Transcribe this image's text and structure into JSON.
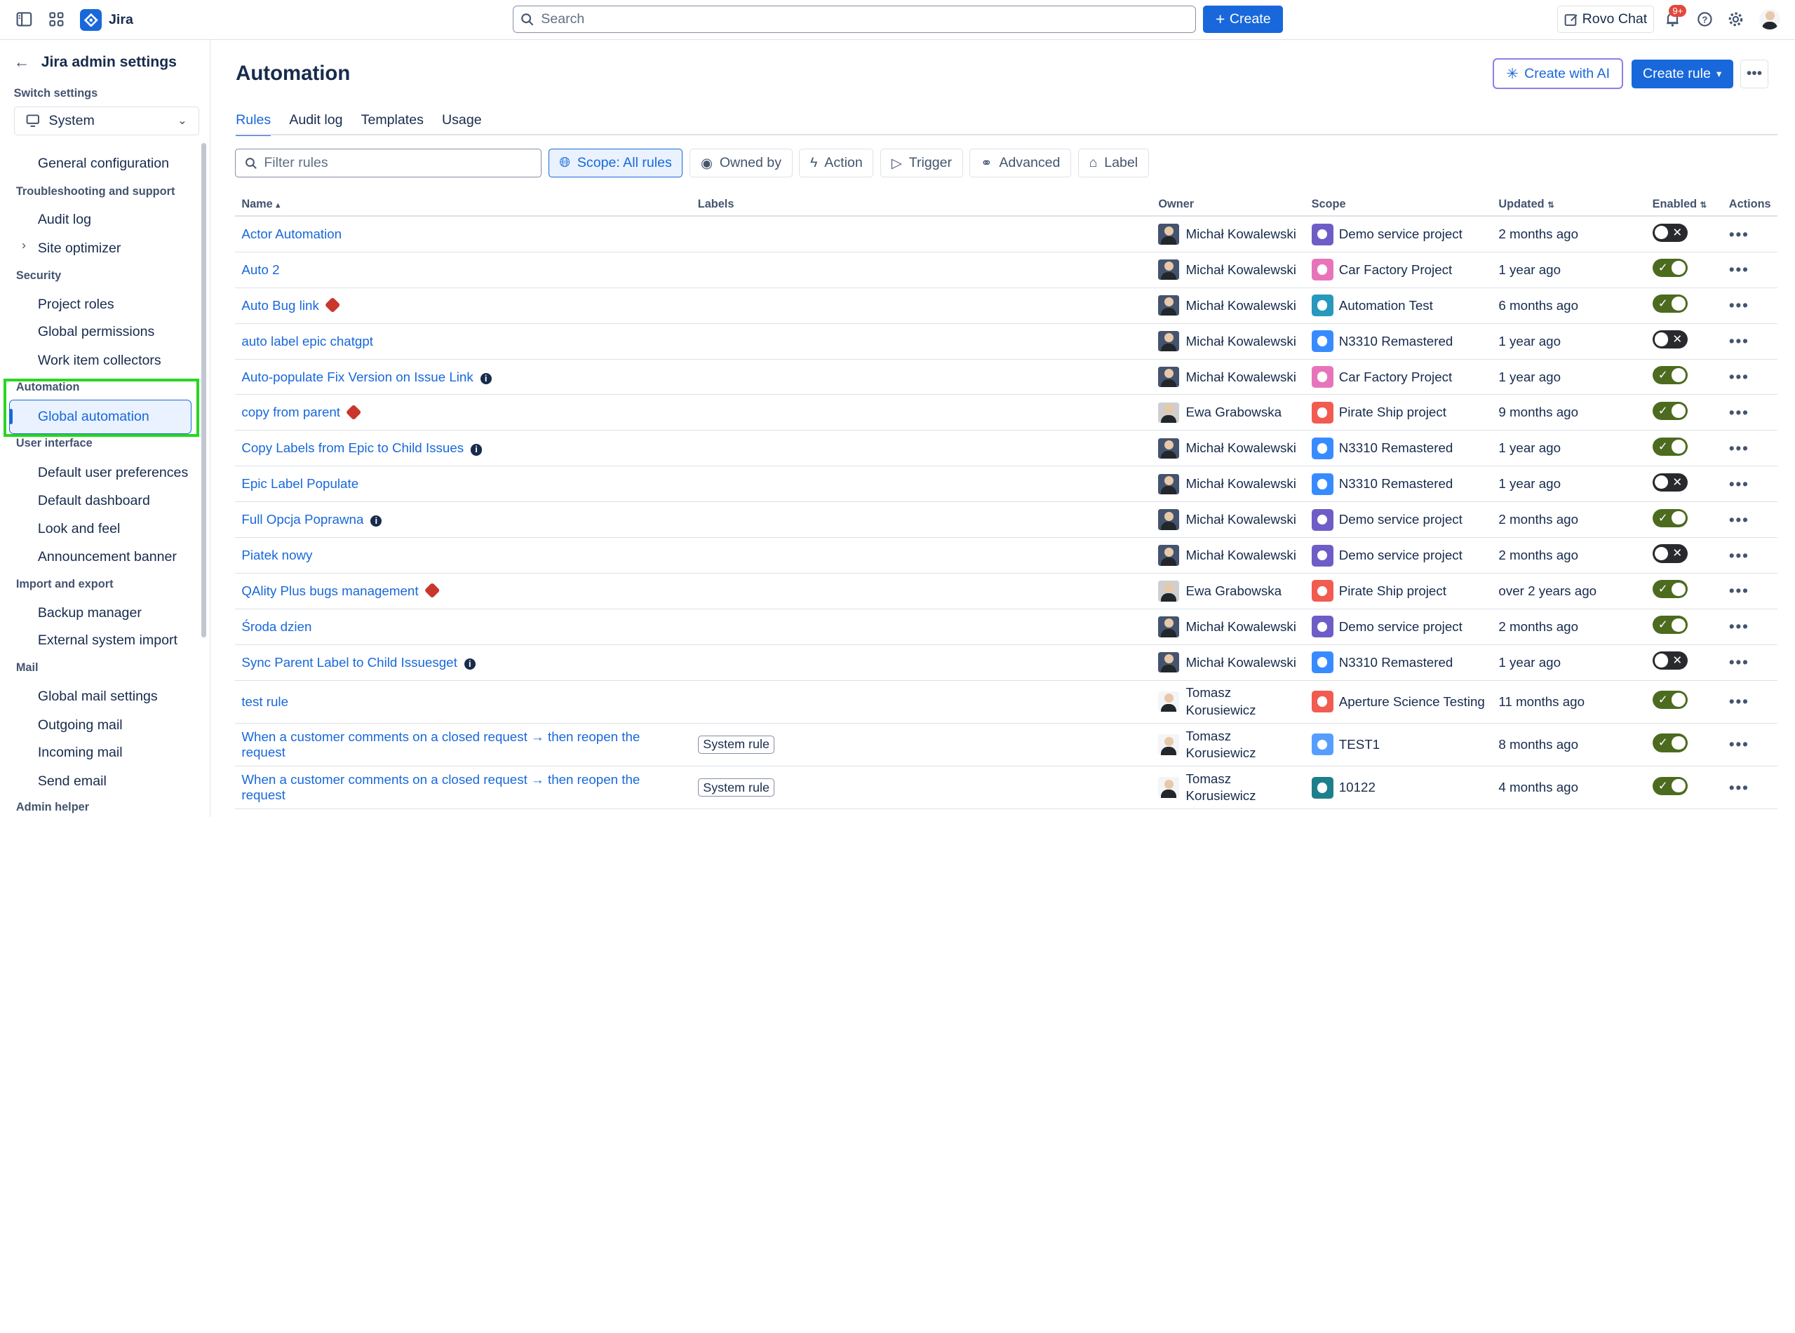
{
  "topbar": {
    "app_name": "Jira",
    "search_placeholder": "Search",
    "create_label": "Create",
    "rovo_label": "Rovo Chat",
    "notification_count": "9+"
  },
  "sidebar": {
    "title": "Jira admin settings",
    "switch_label": "Switch settings",
    "switch_value": "System",
    "general_configuration": "General configuration",
    "sec_troubleshooting": "Troubleshooting and support",
    "audit_log": "Audit log",
    "site_optimizer": "Site optimizer",
    "sec_security": "Security",
    "project_roles": "Project roles",
    "global_permissions": "Global permissions",
    "work_item_collectors": "Work item collectors",
    "sec_automation": "Automation",
    "global_automation": "Global automation",
    "sec_user_interface": "User interface",
    "default_user_preferences": "Default user preferences",
    "default_dashboard": "Default dashboard",
    "look_and_feel": "Look and feel",
    "announcement_banner": "Announcement banner",
    "sec_import_export": "Import and export",
    "backup_manager": "Backup manager",
    "external_system_import": "External system import",
    "sec_mail": "Mail",
    "global_mail_settings": "Global mail settings",
    "outgoing_mail": "Outgoing mail",
    "incoming_mail": "Incoming mail",
    "send_email": "Send email",
    "sec_admin_helper": "Admin helper"
  },
  "main": {
    "title": "Automation",
    "create_ai": "Create with AI",
    "create_rule": "Create rule",
    "tabs": {
      "rules": "Rules",
      "audit_log": "Audit log",
      "templates": "Templates",
      "usage": "Usage"
    },
    "filter_placeholder": "Filter rules",
    "filters": {
      "scope": "Scope: All rules",
      "owned_by": "Owned by",
      "action": "Action",
      "trigger": "Trigger",
      "advanced": "Advanced",
      "label": "Label"
    },
    "columns": {
      "name": "Name",
      "labels": "Labels",
      "owner": "Owner",
      "scope": "Scope",
      "updated": "Updated",
      "enabled": "Enabled",
      "actions": "Actions"
    }
  },
  "colors": {
    "accent": "#1868DB",
    "toggle_on": "#4C6B1F",
    "toggle_off": "#292A2E",
    "highlight": "#27D720",
    "warning": "#C9372C"
  },
  "rules": [
    {
      "name": "Actor Automation",
      "flag": "",
      "label": "",
      "owner": "Michał Kowalewski",
      "avatar": "dark",
      "scope": "Demo service project",
      "scope_color": "#6E5DC6",
      "updated": "2 months ago",
      "enabled": false
    },
    {
      "name": "Auto 2",
      "flag": "",
      "label": "",
      "owner": "Michał Kowalewski",
      "avatar": "dark",
      "scope": "Car Factory Project",
      "scope_color": "#E774BB",
      "updated": "1 year ago",
      "enabled": true
    },
    {
      "name": "Auto Bug link",
      "flag": "warning",
      "label": "",
      "owner": "Michał Kowalewski",
      "avatar": "dark",
      "scope": "Automation Test",
      "scope_color": "#2898BD",
      "updated": "6 months ago",
      "enabled": true
    },
    {
      "name": "auto label epic chatgpt",
      "flag": "",
      "label": "",
      "owner": "Michał Kowalewski",
      "avatar": "dark",
      "scope": "N3310 Remastered",
      "scope_color": "#388BFF",
      "updated": "1 year ago",
      "enabled": false
    },
    {
      "name": "Auto-populate Fix Version on Issue Link",
      "flag": "info",
      "label": "",
      "owner": "Michał Kowalewski",
      "avatar": "dark",
      "scope": "Car Factory Project",
      "scope_color": "#E774BB",
      "updated": "1 year ago",
      "enabled": true
    },
    {
      "name": "copy from parent",
      "flag": "warning",
      "label": "",
      "owner": "Ewa Grabowska",
      "avatar": "light",
      "scope": "Pirate Ship project",
      "scope_color": "#F15B50",
      "updated": "9 months ago",
      "enabled": true
    },
    {
      "name": "Copy Labels from Epic to Child Issues",
      "flag": "info",
      "label": "",
      "owner": "Michał Kowalewski",
      "avatar": "dark",
      "scope": "N3310 Remastered",
      "scope_color": "#388BFF",
      "updated": "1 year ago",
      "enabled": true
    },
    {
      "name": "Epic Label Populate",
      "flag": "",
      "label": "",
      "owner": "Michał Kowalewski",
      "avatar": "dark",
      "scope": "N3310 Remastered",
      "scope_color": "#388BFF",
      "updated": "1 year ago",
      "enabled": false
    },
    {
      "name": "Full Opcja Poprawna",
      "flag": "info",
      "label": "",
      "owner": "Michał Kowalewski",
      "avatar": "dark",
      "scope": "Demo service project",
      "scope_color": "#6E5DC6",
      "updated": "2 months ago",
      "enabled": true
    },
    {
      "name": "Piatek nowy",
      "flag": "",
      "label": "",
      "owner": "Michał Kowalewski",
      "avatar": "dark",
      "scope": "Demo service project",
      "scope_color": "#6E5DC6",
      "updated": "2 months ago",
      "enabled": false
    },
    {
      "name": "QAlity Plus bugs management",
      "flag": "warning",
      "label": "",
      "owner": "Ewa Grabowska",
      "avatar": "light",
      "scope": "Pirate Ship project",
      "scope_color": "#F15B50",
      "updated": "over 2 years ago",
      "enabled": true
    },
    {
      "name": "Środa dzien",
      "flag": "",
      "label": "",
      "owner": "Michał Kowalewski",
      "avatar": "dark",
      "scope": "Demo service project",
      "scope_color": "#6E5DC6",
      "updated": "2 months ago",
      "enabled": true
    },
    {
      "name": "Sync Parent Label to Child Issuesget",
      "flag": "info",
      "label": "",
      "owner": "Michał Kowalewski",
      "avatar": "dark",
      "scope": "N3310 Remastered",
      "scope_color": "#388BFF",
      "updated": "1 year ago",
      "enabled": false
    },
    {
      "name": "test rule",
      "flag": "",
      "label": "",
      "owner": "Tomasz Korusiewicz",
      "avatar": "white",
      "scope": "Aperture Science Testing",
      "scope_color": "#F15B50",
      "updated": "11 months ago",
      "enabled": true
    },
    {
      "name": "When a customer comments on a closed request → then reopen the request",
      "flag": "",
      "label": "System rule",
      "owner": "Tomasz Korusiewicz",
      "avatar": "white",
      "scope": "TEST1",
      "scope_color": "#579DFF",
      "updated": "8 months ago",
      "enabled": true
    },
    {
      "name": "When a customer comments on a closed request → then reopen the request",
      "flag": "",
      "label": "System rule",
      "owner": "Tomasz Korusiewicz",
      "avatar": "white",
      "scope": "10122",
      "scope_color": "#1D7F8C",
      "updated": "4 months ago",
      "enabled": true
    }
  ]
}
